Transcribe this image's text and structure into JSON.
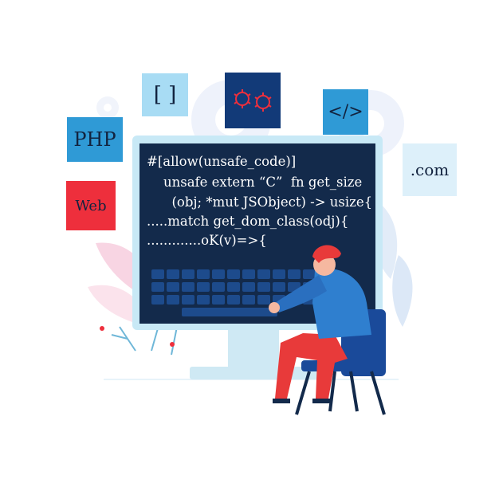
{
  "tags": {
    "php": "PHP",
    "web": "Web",
    "brackets": "[ ]",
    "code": "</>",
    "dotcom": ".com"
  },
  "code_lines": [
    "#[allow(unsafe_code)]",
    "    unsafe extern “C”  fn get_size",
    "      (obj; *mut JSObject) -> usize{",
    ".....match get_dom_class(odj){",
    ".............oK(v)=>{"
  ],
  "icons": {
    "bugs": "two-bugs-icon",
    "gears": "gear-icon"
  },
  "colors": {
    "screen": "#132a4b",
    "accent_blue": "#2f9ad6",
    "accent_red": "#ee2f3c",
    "dark_blue": "#123a78",
    "light_blue": "#a8dcf4"
  }
}
